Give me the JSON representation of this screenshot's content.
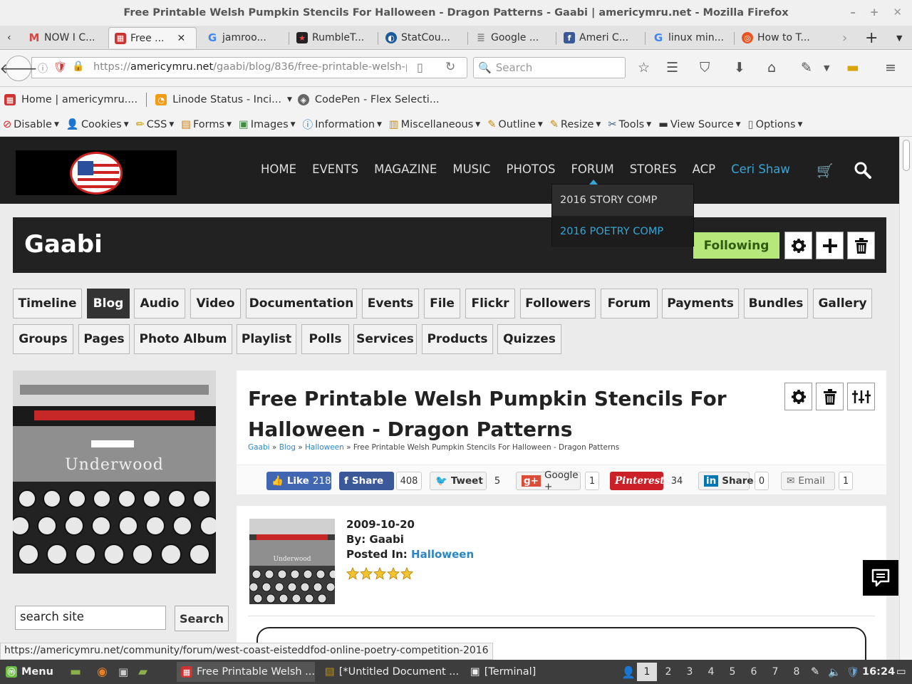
{
  "window": {
    "title": "Free Printable Welsh Pumpkin Stencils For Halloween - Dragon Patterns - Gaabi | americymru.net - Mozilla Firefox"
  },
  "tabs": [
    {
      "label": "NOW I C...",
      "icon": "gmail-icon"
    },
    {
      "label": "Free ...",
      "icon": "americymru-icon",
      "active": true
    },
    {
      "label": "jamroo...",
      "icon": "google-icon"
    },
    {
      "label": "RumbleT...",
      "icon": "rumble-icon"
    },
    {
      "label": "StatCou...",
      "icon": "statcounter-icon"
    },
    {
      "label": "Google ...",
      "icon": "google-docs-icon"
    },
    {
      "label": "Ameri C...",
      "icon": "facebook-icon"
    },
    {
      "label": "linux min...",
      "icon": "google-icon"
    },
    {
      "label": "How to T...",
      "icon": "ubuntu-icon"
    }
  ],
  "nav": {
    "url_prefix": "https://",
    "url_domain": "americymru.net",
    "url_path": "/gaabi/blog/836/free-printable-welsh-p",
    "search_placeholder": "Search"
  },
  "bookmarks": [
    {
      "label": "Home | americymru...."
    },
    {
      "label": "Linode Status - Inci..."
    },
    {
      "label": "CodePen - Flex Selecti..."
    }
  ],
  "devbar": [
    "Disable",
    "Cookies",
    "CSS",
    "Forms",
    "Images",
    "Information",
    "Miscellaneous",
    "Outline",
    "Resize",
    "Tools",
    "View Source",
    "Options"
  ],
  "site": {
    "menu": [
      "HOME",
      "EVENTS",
      "MAGAZINE",
      "MUSIC",
      "PHOTOS",
      "FORUM",
      "STORES",
      "ACP"
    ],
    "user": "Ceri Shaw",
    "forum_dropdown": [
      "2016 STORY COMP",
      "2016 POETRY COMP"
    ]
  },
  "profile": {
    "name": "Gaabi",
    "following_label": "Following"
  },
  "subtabs_row1": [
    "Timeline",
    "Blog",
    "Audio",
    "Video",
    "Documentation",
    "Events",
    "File",
    "Flickr",
    "Followers",
    "Forum",
    "Payments",
    "Bundles",
    "Gallery"
  ],
  "subtabs_row2": [
    "Groups",
    "Pages",
    "Photo Album",
    "Playlist",
    "Polls",
    "Services",
    "Products",
    "Quizzes"
  ],
  "sidebar": {
    "image_label": "Underwood",
    "search_value": "search site",
    "search_button": "Search"
  },
  "article": {
    "title": "Free Printable Welsh Pumpkin Stencils For Halloween - Dragon Patterns",
    "crumbs": [
      "Gaabi",
      "Blog",
      "Halloween",
      "Free Printable Welsh Pumpkin Stencils For Halloween - Dragon Patterns"
    ]
  },
  "share": {
    "like": "Like",
    "like_count": "218",
    "fb_share": "Share",
    "fb_count": "408",
    "tweet": "Tweet",
    "tweet_count": "5",
    "google": "Google +",
    "google_count": "1",
    "pinterest": "Pinterest",
    "pinterest_count": "34",
    "linkedin": "Share",
    "linkedin_count": "0",
    "email": "Email",
    "email_count": "1"
  },
  "post": {
    "date": "2009-10-20",
    "by": "By: Gaabi",
    "posted_in_label": "Posted In: ",
    "category": "Halloween",
    "thumb_label": "Underwood",
    "rating": 5
  },
  "status_url": "https://americymru.net/community/forum/west-coast-eisteddfod-online-poetry-competition-2016",
  "taskbar": {
    "menu": "Menu",
    "tasks": [
      "Free Printable Welsh ...",
      "[*Untitled Document ...",
      "[Terminal]"
    ],
    "workspaces": [
      "1",
      "2",
      "3",
      "4",
      "5",
      "6",
      "7",
      "8"
    ],
    "clock": "16:24"
  },
  "colors": {
    "accent_blue": "#35a6d6",
    "following_green": "#b6e77a",
    "facebook": "#3b5998",
    "twitter": "#55acee",
    "google": "#dd4b39",
    "pinterest": "#cb2027",
    "linkedin": "#0077b5"
  }
}
